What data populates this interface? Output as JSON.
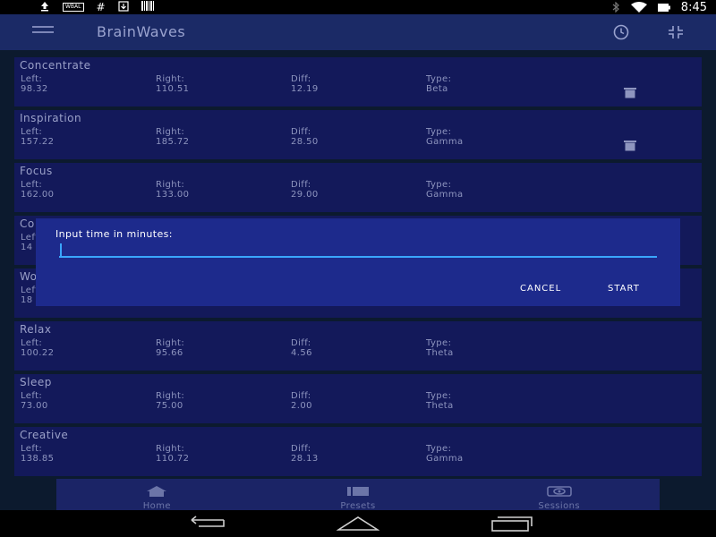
{
  "status_bar": {
    "icons": [
      "upload-icon",
      "wbal-icon",
      "hashtag-icon",
      "download-icon",
      "barcode-icon",
      "bluetooth-icon",
      "wifi-icon",
      "battery-icon"
    ],
    "wbal_text": "WBAL",
    "time": "8:45"
  },
  "app_bar": {
    "title": "BrainWaves",
    "icons": [
      "menu-icon",
      "history-clock-icon",
      "collapse-icon"
    ]
  },
  "labels": {
    "left": "Left:",
    "right": "Right:",
    "diff": "Diff:",
    "type": "Type:"
  },
  "presets": [
    {
      "name": "Concentrate",
      "left": "98.32",
      "right": "110.51",
      "diff": "12.19",
      "type": "Beta",
      "deletable": true
    },
    {
      "name": "Inspiration",
      "left": "157.22",
      "right": "185.72",
      "diff": "28.50",
      "type": "Gamma",
      "deletable": true
    },
    {
      "name": "Focus",
      "left": "162.00",
      "right": "133.00",
      "diff": "29.00",
      "type": "Gamma",
      "deletable": false
    },
    {
      "name": "Co",
      "left": "14",
      "right": "",
      "diff": "",
      "type": "",
      "deletable": false
    },
    {
      "name": "Wo",
      "left": "18",
      "right": "",
      "diff": "",
      "type": "",
      "deletable": false
    },
    {
      "name": "Relax",
      "left": "100.22",
      "right": "95.66",
      "diff": "4.56",
      "type": "Theta",
      "deletable": false
    },
    {
      "name": "Sleep",
      "left": "73.00",
      "right": "75.00",
      "diff": "2.00",
      "type": "Theta",
      "deletable": false
    },
    {
      "name": "Creative",
      "left": "138.85",
      "right": "110.72",
      "diff": "28.13",
      "type": "Gamma",
      "deletable": false
    }
  ],
  "dialog": {
    "label": "Input time in minutes:",
    "input_value": "",
    "cancel_label": "CANCEL",
    "start_label": "START",
    "accent_color": "#3aa6ff"
  },
  "bottom_nav": {
    "items": [
      {
        "label": "Home",
        "icon": "home-icon"
      },
      {
        "label": "Presets",
        "icon": "presets-icon"
      },
      {
        "label": "Sessions",
        "icon": "sessions-icon"
      }
    ]
  },
  "system_nav": {
    "icons": [
      "back-icon",
      "home-button-icon",
      "recents-icon"
    ]
  },
  "colors": {
    "app_bar": "#1b2a66",
    "card": "#13195a",
    "dialog": "#1d2a8c",
    "background": "#0c1a2e"
  }
}
